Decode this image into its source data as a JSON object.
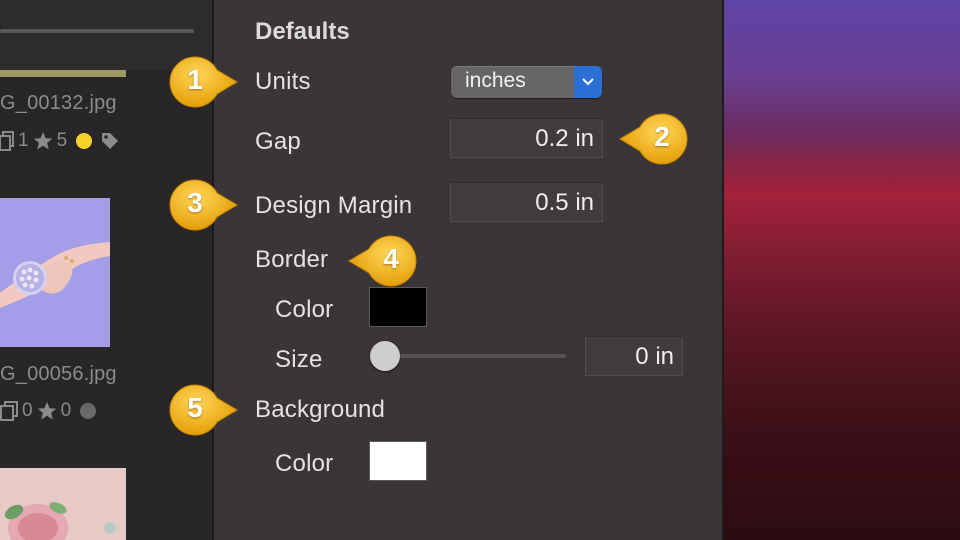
{
  "browser": {
    "items": [
      {
        "filename": "G_00132.jpg",
        "copies": "1",
        "rating": "5"
      },
      {
        "filename": "G_00056.jpg",
        "copies": "0",
        "rating": "0"
      }
    ]
  },
  "panel": {
    "heading": "Defaults",
    "units": {
      "label": "Units",
      "value": "inches"
    },
    "gap": {
      "label": "Gap",
      "value": "0.2 in"
    },
    "design_margin": {
      "label": "Design Margin",
      "value": "0.5 in"
    },
    "border": {
      "label": "Border",
      "color_label": "Color",
      "color": "#000000",
      "size_label": "Size",
      "size_value": "0 in",
      "size_level": 0
    },
    "background": {
      "label": "Background",
      "color_label": "Color",
      "color": "#ffffff"
    }
  },
  "callouts": [
    "1",
    "2",
    "3",
    "4",
    "5"
  ],
  "colors": {
    "accent": "#2b6fd7",
    "callout": "#f2b310",
    "color_label_yellow": "#f5d328"
  }
}
